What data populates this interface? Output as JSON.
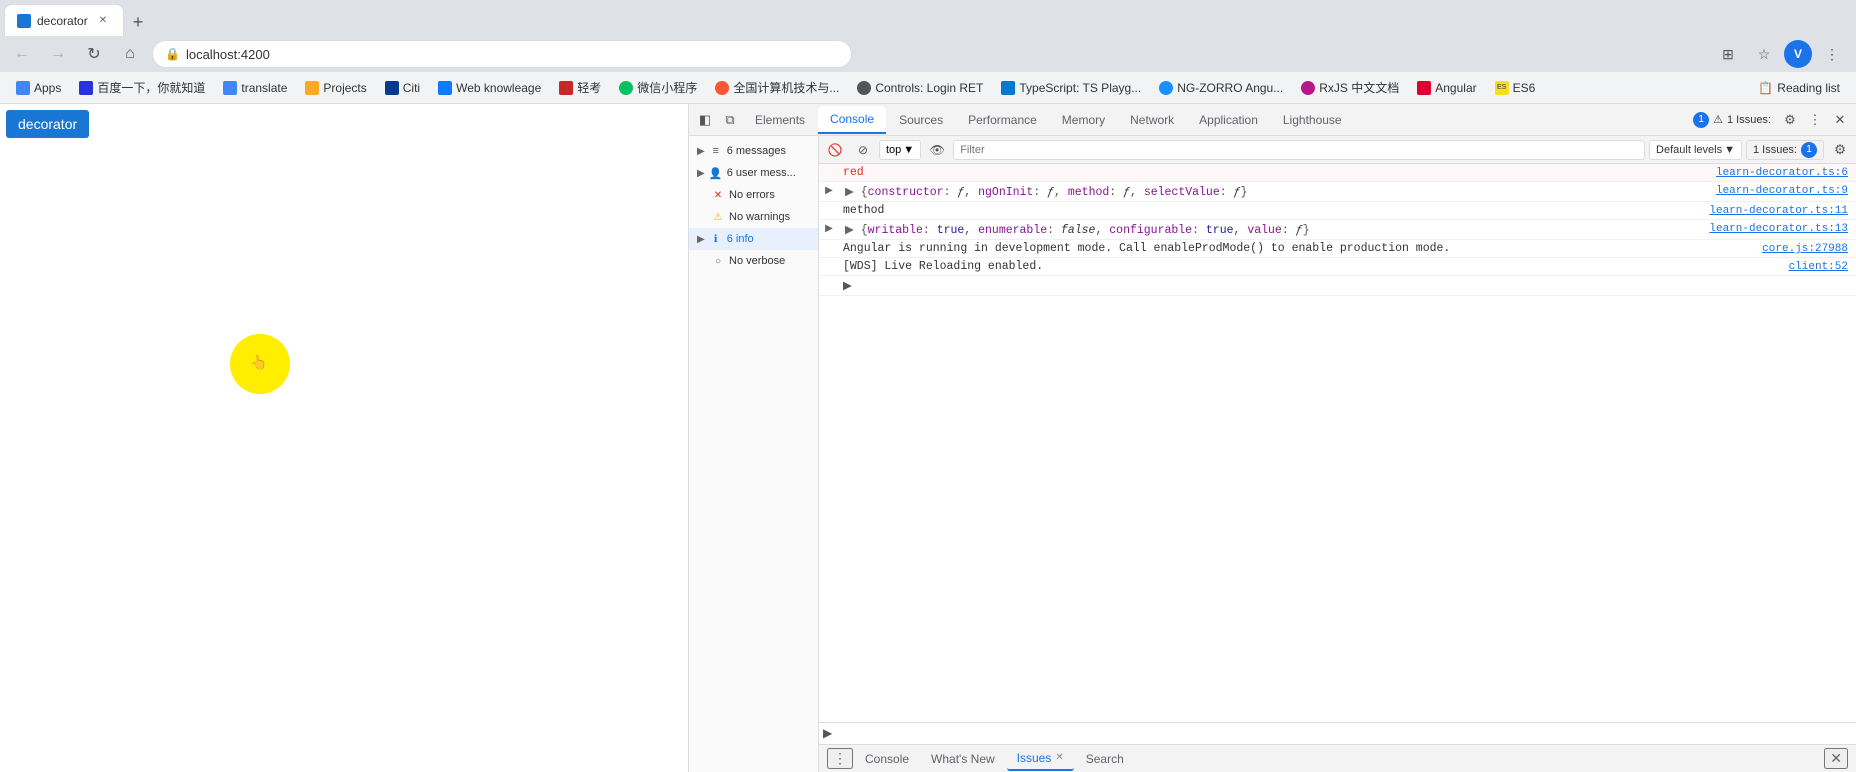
{
  "browser": {
    "url": "localhost:4200",
    "tab_title": "decorator",
    "tab_favicon_color": "#1976d2"
  },
  "bookmarks": [
    {
      "label": "Apps",
      "icon": "apps",
      "favicon_class": "favicon-apps"
    },
    {
      "label": "百度一下，你就知道",
      "icon": "baidu",
      "favicon_class": "favicon-baidu"
    },
    {
      "label": "translate",
      "icon": "translate",
      "favicon_class": "favicon-translate"
    },
    {
      "label": "Projects",
      "icon": "projects",
      "favicon_class": "favicon-projects"
    },
    {
      "label": "Citi",
      "icon": "citi",
      "favicon_class": "favicon-citi"
    },
    {
      "label": "Web knowleage",
      "icon": "web",
      "favicon_class": "favicon-web"
    },
    {
      "label": "轻考",
      "icon": "ielts",
      "favicon_class": "favicon-ielts"
    },
    {
      "label": "微信小程序",
      "icon": "wechat",
      "favicon_class": "favicon-wechat"
    },
    {
      "label": "全国计算机技术与...",
      "icon": "csdn",
      "favicon_class": "favicon-csdn"
    },
    {
      "label": "Controls: Login RET",
      "icon": "controls",
      "favicon_class": "favicon-controls"
    },
    {
      "label": "TypeScript: TS Playg...",
      "icon": "ts",
      "favicon_class": "favicon-ts"
    },
    {
      "label": "NG-ZORRO Angu...",
      "icon": "ng-zorro",
      "favicon_class": "favicon-ng-zorro"
    },
    {
      "label": "RxJS 中文文档",
      "icon": "rxjs",
      "favicon_class": "favicon-rxjs"
    },
    {
      "label": "Angular",
      "icon": "angular",
      "favicon_class": "favicon-angular"
    },
    {
      "label": "ES6",
      "icon": "es6",
      "favicon_class": "favicon-es6"
    },
    {
      "label": "Reading list",
      "icon": "reading",
      "favicon_class": "favicon-web"
    }
  ],
  "devtools": {
    "tabs": [
      "Elements",
      "Console",
      "Sources",
      "Performance",
      "Memory",
      "Network",
      "Application",
      "Lighthouse"
    ],
    "active_tab": "Console",
    "toolbar": {
      "top_label": "top",
      "filter_placeholder": "Filter",
      "default_levels_label": "Default levels",
      "issues_label": "1 Issues:",
      "issues_count": "1"
    },
    "sidebar": {
      "items": [
        {
          "label": "6 messages",
          "icon": "list",
          "expandable": true
        },
        {
          "label": "6 user mess...",
          "icon": "user",
          "expandable": true
        },
        {
          "label": "No errors",
          "icon": "error",
          "expandable": false
        },
        {
          "label": "No warnings",
          "icon": "warning",
          "expandable": false
        },
        {
          "label": "6 info",
          "icon": "info",
          "expandable": true,
          "active": true
        },
        {
          "label": "No verbose",
          "icon": "verbose",
          "expandable": false
        }
      ]
    },
    "console_log": [
      {
        "type": "red",
        "expand": false,
        "content": "red",
        "source": "learn-decorator.ts:6"
      },
      {
        "type": "obj",
        "expand": true,
        "content": "▶ {constructor: ƒ, ngOnInit: ƒ, method: ƒ, selectValue: ƒ}",
        "source": "learn-decorator.ts:9"
      },
      {
        "type": "text",
        "expand": false,
        "content": "method",
        "source": "learn-decorator.ts:11"
      },
      {
        "type": "obj",
        "expand": true,
        "content": "▶ {writable: true, enumerable: false, configurable: true, value: ƒ}",
        "source": "learn-decorator.ts:13"
      },
      {
        "type": "angular",
        "expand": false,
        "content": "Angular is running in development mode. Call enableProdMode() to enable production mode.",
        "source": "core.js:27988"
      },
      {
        "type": "wds",
        "expand": false,
        "content": "[WDS] Live Reloading enabled.",
        "source": "client:52"
      },
      {
        "type": "prompt",
        "expand": false,
        "content": "▶",
        "source": ""
      }
    ],
    "bottom_tabs": [
      "Console",
      "What's New",
      "Issues",
      "Search"
    ],
    "active_bottom_tab": "Issues",
    "issues_bottom_close": true
  },
  "app": {
    "button_label": "decorator"
  },
  "icons": {
    "back": "←",
    "forward": "→",
    "reload": "↻",
    "home": "⌂",
    "lock": "🔒",
    "star": "☆",
    "extensions": "⊞",
    "profile": "V",
    "menu": "⋮",
    "new_tab": "+",
    "devtools_close": "✕",
    "devtools_more": "⋮",
    "dock_side": "◧",
    "new_window": "⧉",
    "expand": "▶",
    "collapse": "▼"
  }
}
